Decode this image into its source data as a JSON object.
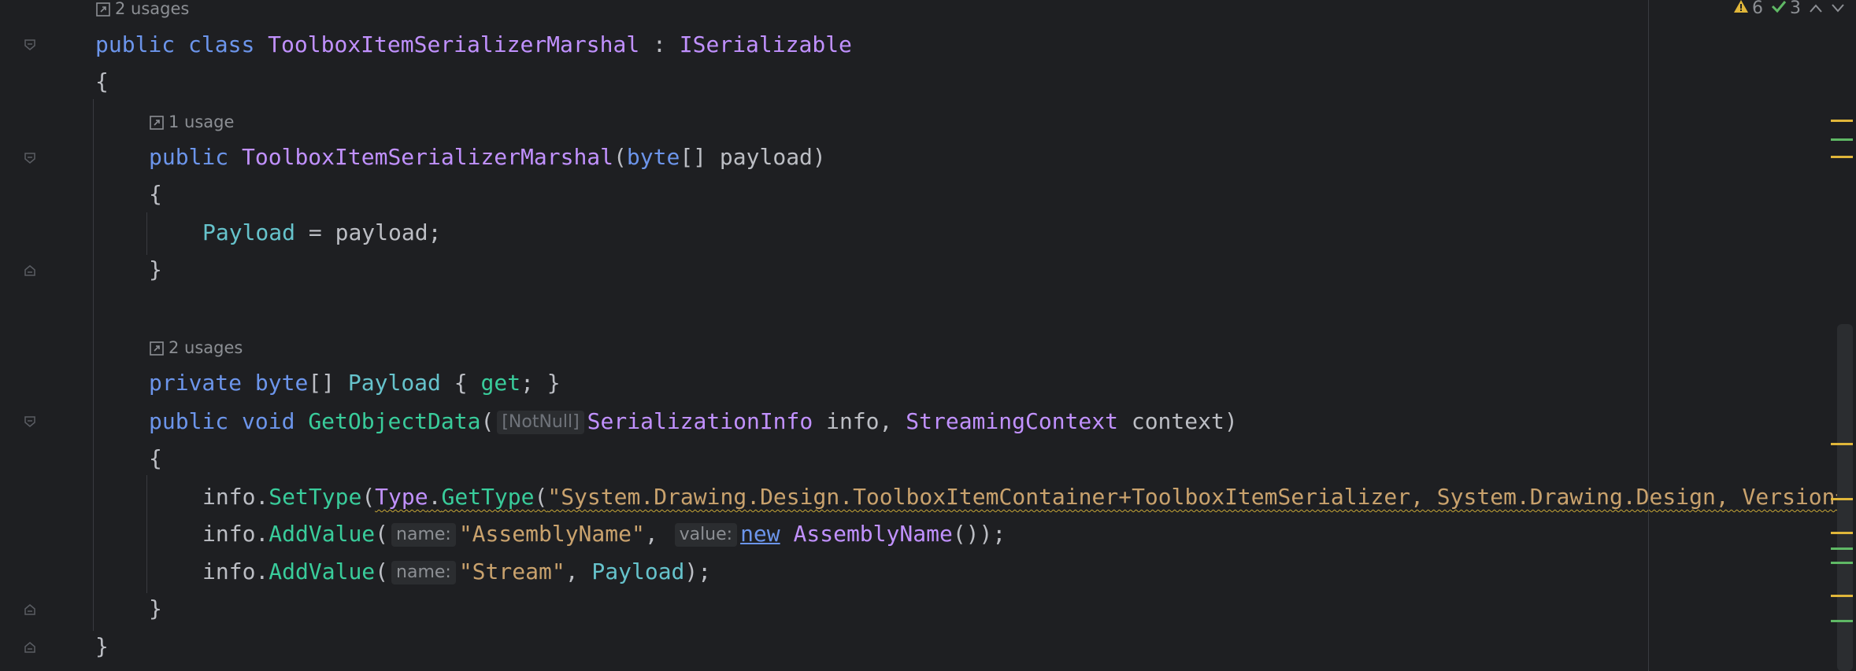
{
  "status": {
    "warnings": "6",
    "ok": "3"
  },
  "hints": {
    "class_usages": "2 usages",
    "ctor_usages": "1 usage",
    "prop_usages": "2 usages"
  },
  "code": {
    "l1_public": "public",
    "l1_class": "class",
    "l1_name": "ToolboxItemSerializerMarshal",
    "l1_colon": " : ",
    "l1_iface": "ISerializable",
    "l2_brace": "{",
    "l3_public": "public",
    "l3_name": "ToolboxItemSerializerMarshal",
    "l3_open": "(",
    "l3_type": "byte",
    "l3_rest": "[] payload)",
    "l4_brace": "{",
    "l5_prop": "Payload",
    "l5_rest": " = payload;",
    "l6_brace": "}",
    "l7_private": "private",
    "l7_byte": "byte",
    "l7_arr": "[] ",
    "l7_prop": "Payload",
    "l7_ob": " { ",
    "l7_get": "get",
    "l7_cb": "; }",
    "l8_public": "public",
    "l8_void": "void",
    "l8_meth": "GetObjectData",
    "l8_open": "(",
    "l8_attr": "[NotNull]",
    "l8_type1": "SerializationInfo",
    "l8_p1": " info, ",
    "l8_type2": "StreamingContext",
    "l8_p2": " context)",
    "l9_brace": "{",
    "l10_info": "info.",
    "l10_settype": "SetType",
    "l10_open": "(",
    "l10_type": "Type",
    "l10_dot": ".",
    "l10_gettype": "GetType",
    "l10_open2": "(",
    "l10_str": "\"System.Drawing.Design.ToolboxItemContainer+ToolboxItemSerializer, System.Drawing.Design, Version=",
    "l11_info": "info.",
    "l11_add": "AddValue",
    "l11_open": "(",
    "l11_hint_name": "name:",
    "l11_str": "\"AssemblyName\"",
    "l11_comma": ", ",
    "l11_hint_value": "value:",
    "l11_new": "new",
    "l11_cls": "AssemblyName",
    "l11_end": "());",
    "l12_info": "info.",
    "l12_add": "AddValue",
    "l12_open": "(",
    "l12_hint_name": "name:",
    "l12_str": "\"Stream\"",
    "l12_comma": ", ",
    "l12_prop": "Payload",
    "l12_end": ");",
    "l13_brace": "}",
    "l14_brace": "}"
  },
  "icons": {
    "warning": "warning-icon",
    "ok": "check-icon",
    "up": "chevron-up-icon",
    "down": "chevron-down-icon",
    "usages": "usages-link-icon",
    "fold": "fold-marker-icon"
  },
  "colors": {
    "background": "#1e1f22",
    "keyword": "#6c95eb",
    "class": "#c191ff",
    "method": "#39cc9b",
    "property": "#66c3cc",
    "string": "#c9a26d",
    "warning_mark": "#e0b63a",
    "ok_mark": "#5fb865"
  }
}
